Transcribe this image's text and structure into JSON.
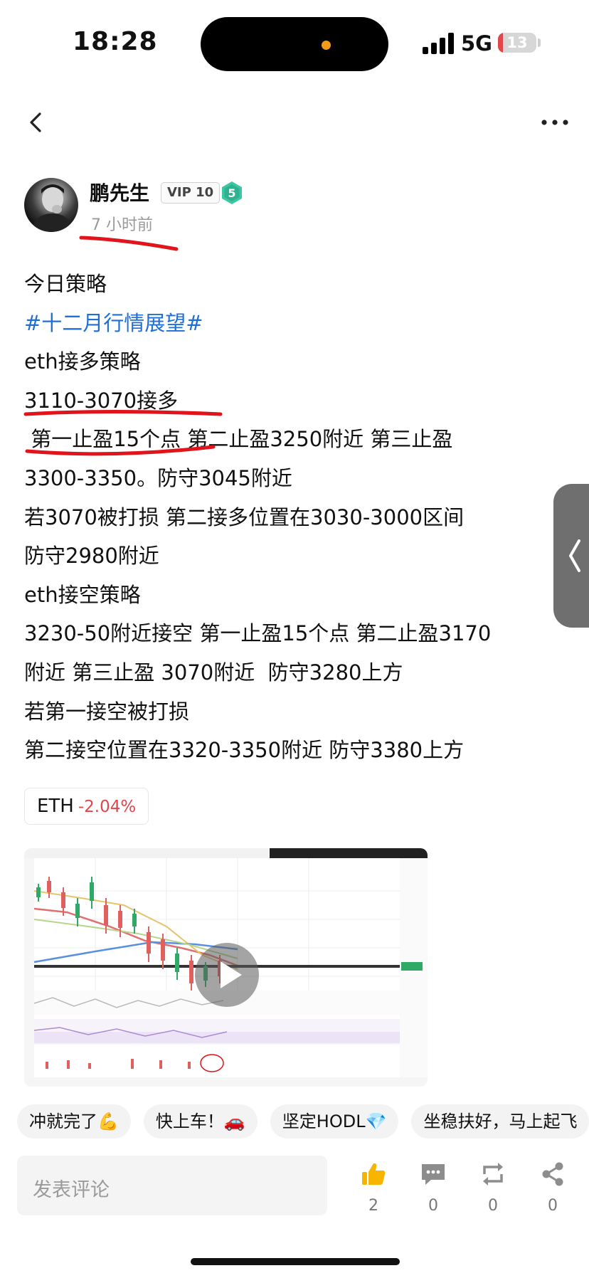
{
  "status_bar": {
    "time": "18:28",
    "network": "5G",
    "battery_level": "13"
  },
  "nav": {
    "back_icon": "chevron-left-icon",
    "more_icon": "more-horizontal-icon"
  },
  "author": {
    "name": "鹏先生",
    "vip_badge": "VIP 10",
    "level": "5",
    "post_time": "7 小时前"
  },
  "post": {
    "lines": [
      "今日策略",
      "#十二月行情展望#",
      "eth接多策略",
      "3110-3070接多",
      " 第一止盈15个点 第二止盈3250附近 第三止盈",
      "3300-3350。防守3045附近",
      "若3070被打损 第二接多位置在3030-3000区间",
      "防守2980附近",
      "eth接空策略",
      "3230-50附近接空 第一止盈15个点 第二止盈3170",
      "附近 第三止盈 3070附近  防守3280上方",
      "若第一接空被打损",
      "第二接空位置在3320-3350附近 防守3380上方"
    ]
  },
  "ticker": {
    "symbol": "ETH",
    "change": "-2.04%"
  },
  "video": {
    "play_icon": "play-icon",
    "thumbnail": "eth-candlestick-chart"
  },
  "quick_replies": [
    "冲就完了💪",
    "快上车！🚗",
    "坚定HODL💎",
    "坐稳扶好，马上起飞"
  ],
  "comment": {
    "placeholder": "发表评论"
  },
  "actions": {
    "like_count": "2",
    "comment_count": "0",
    "repost_count": "0",
    "share_count": "0"
  },
  "colors": {
    "hashtag": "#1f6fd6",
    "negative": "#e0464b",
    "annotation": "#e0141a"
  }
}
